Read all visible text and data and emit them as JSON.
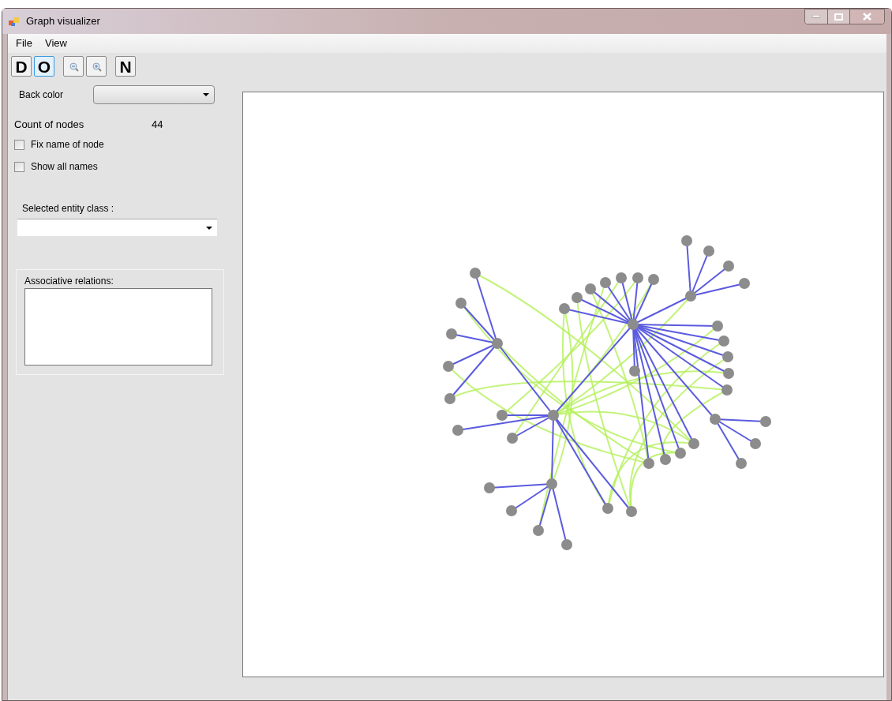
{
  "window": {
    "title": "Graph visualizer"
  },
  "menu": [
    "File",
    "View"
  ],
  "toolbar": [
    {
      "kind": "text",
      "label": "D",
      "selected": false
    },
    {
      "kind": "text",
      "label": "O",
      "selected": true
    },
    {
      "kind": "zoom-out",
      "selected": false
    },
    {
      "kind": "zoom-in",
      "selected": false
    },
    {
      "kind": "text",
      "label": "N",
      "selected": false
    }
  ],
  "back_color": {
    "label": "Back color"
  },
  "count_of_nodes": {
    "label": "Count of nodes",
    "value": "44"
  },
  "checkboxes": [
    {
      "label": "Fix name of node",
      "checked": false
    },
    {
      "label": "Show all names",
      "checked": false
    }
  ],
  "selected_entity_class": {
    "label": "Selected entity class :"
  },
  "associative_relations": {
    "label": "Associative relations:"
  }
}
